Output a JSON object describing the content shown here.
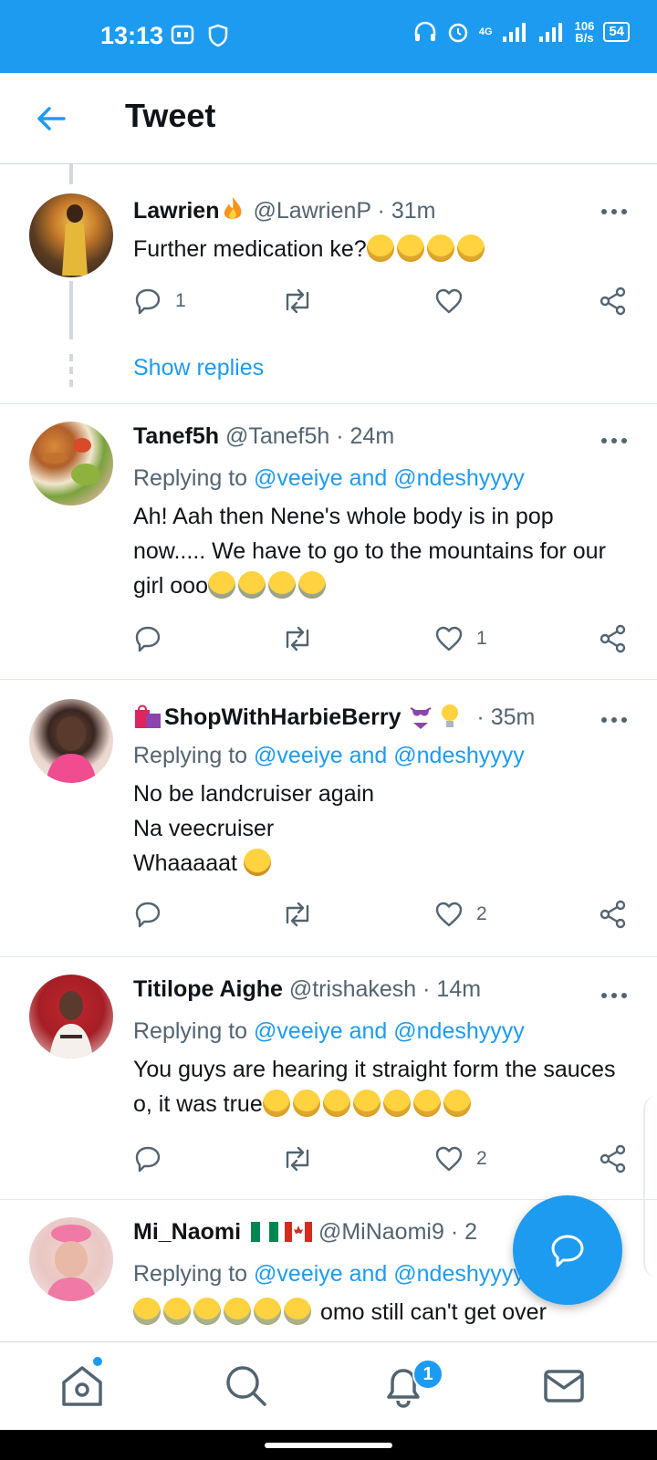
{
  "status_bar": {
    "time": "13:13",
    "network": "4G",
    "speed_value": "106",
    "speed_unit": "B/s",
    "battery": "54"
  },
  "header": {
    "title": "Tweet"
  },
  "colors": {
    "accent": "#1d9bf0",
    "text_primary": "#0f1419",
    "text_secondary": "#536471"
  },
  "tweets": [
    {
      "name": "Lawrien",
      "handle": "@LawrienP",
      "time": "31m",
      "replying_prefix": "",
      "text": "Further medication ke?",
      "emojis": 4,
      "reply_count": "1",
      "retweet_count": "",
      "like_count": "",
      "show_replies": "Show replies"
    },
    {
      "name": "Tanef5h",
      "handle": "@Tanef5h",
      "time": "24m",
      "replying_prefix": "Replying to",
      "replying_to": "@veeiye and @ndeshyyyy",
      "text": "Ah! Aah then Nene's whole body is in pop now..... We have to go to the mountains for our girl ooo",
      "reply_count": "",
      "retweet_count": "",
      "like_count": "1"
    },
    {
      "name": "ShopWithHarbieBerry",
      "handle": "",
      "time": "35m",
      "replying_prefix": "Replying to",
      "replying_to": "@veeiye and @ndeshyyyy",
      "line1": "No be landcruiser again",
      "line2": "Na veecruiser",
      "line3": "Whaaaaat",
      "reply_count": "",
      "retweet_count": "",
      "like_count": "2"
    },
    {
      "name": "Titilope Aighe",
      "handle": "@trishakesh",
      "time": "14m",
      "replying_prefix": "Replying to",
      "replying_to": "@veeiye and @ndeshyyyy",
      "text": "You guys are hearing it straight form the sauces o, it was true",
      "reply_count": "",
      "retweet_count": "",
      "like_count": "2"
    },
    {
      "name": "Mi_Naomi",
      "handle": "@MiNaomi9",
      "time": "2",
      "replying_prefix": "Replying to",
      "replying_to": "@veeiye and @ndeshyyyy",
      "text": "omo still can't get over"
    }
  ],
  "bottom_nav": {
    "notifications_badge": "1",
    "items": [
      "home-icon",
      "search-icon",
      "notifications-icon",
      "messages-icon"
    ]
  }
}
